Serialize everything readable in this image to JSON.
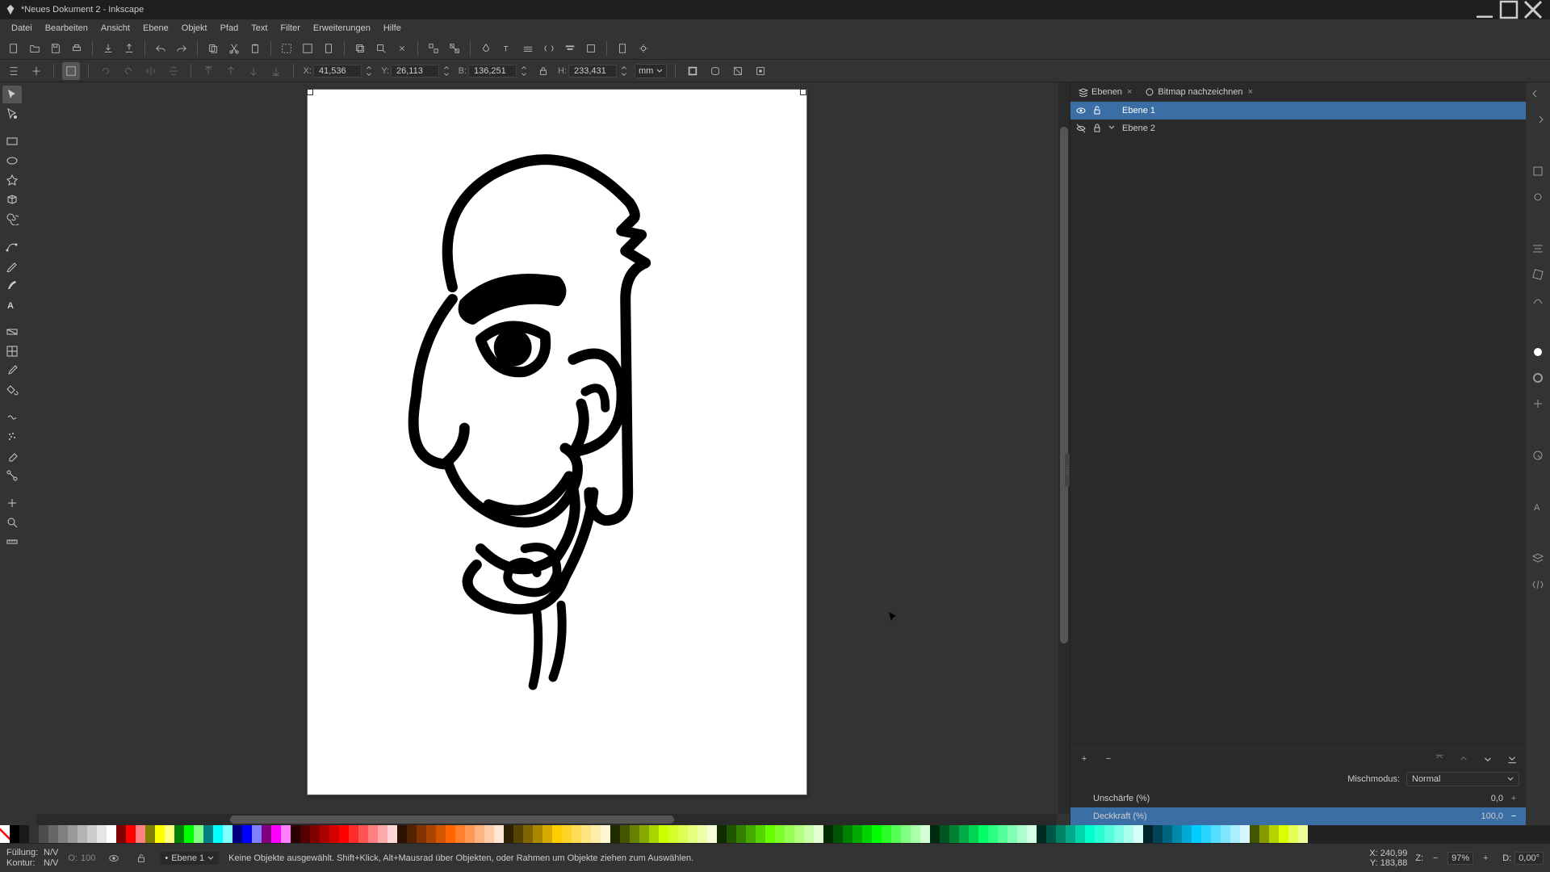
{
  "window": {
    "title": "*Neues Dokument 2 - Inkscape"
  },
  "menu": [
    "Datei",
    "Bearbeiten",
    "Ansicht",
    "Ebene",
    "Objekt",
    "Pfad",
    "Text",
    "Filter",
    "Erweiterungen",
    "Hilfe"
  ],
  "snapbar": {
    "x_label": "X:",
    "x": "41,536",
    "y_label": "Y:",
    "y": "26,113",
    "b_label": "B:",
    "b": "136,251",
    "h_label": "H:",
    "h": "233,431",
    "unit": "mm"
  },
  "panels": {
    "tab1": "Ebenen",
    "tab2": "Bitmap nachzeichnen",
    "layer1": "Ebene 1",
    "layer2": "Ebene 2",
    "blend_label": "Mischmodus:",
    "blend_value": "Normal",
    "blur_label": "Unschärfe (%)",
    "blur_value": "0,0",
    "opacity_label": "Deckkraft (%)",
    "opacity_value": "100,0"
  },
  "status": {
    "fill_label": "Füllung:",
    "fill_value": "N/V",
    "stroke_label": "Kontur:",
    "stroke_value": "N/V",
    "o_label": "O:",
    "o_value": "100",
    "layer_prefix": "•",
    "layer": "Ebene 1",
    "msg": "Keine Objekte ausgewählt. Shift+Klick, Alt+Mausrad über Objekten, oder Rahmen um Objekte ziehen zum Auswählen.",
    "coord_x_label": "X:",
    "coord_x": "240,99",
    "coord_y_label": "Y:",
    "coord_y": "183,88",
    "z_label": "Z:",
    "zoom": "97%",
    "d_label": "D:",
    "rotation": "0,00°"
  },
  "palette_colors": [
    "#000000",
    "#1a1a1a",
    "#333333",
    "#4d4d4d",
    "#666666",
    "#808080",
    "#999999",
    "#b3b3b3",
    "#cccccc",
    "#e6e6e6",
    "#ffffff",
    "#800000",
    "#ff0000",
    "#ff8080",
    "#808000",
    "#ffff00",
    "#ffff80",
    "#008000",
    "#00ff00",
    "#80ff80",
    "#008080",
    "#00ffff",
    "#80ffff",
    "#000080",
    "#0000ff",
    "#8080ff",
    "#800080",
    "#ff00ff",
    "#ff80ff",
    "#2b0000",
    "#550000",
    "#800000",
    "#aa0000",
    "#d40000",
    "#ff0000",
    "#ff2a2a",
    "#ff5555",
    "#ff8080",
    "#ffaaaa",
    "#ffd5d5",
    "#2b1100",
    "#552200",
    "#803300",
    "#aa4400",
    "#d45500",
    "#ff6600",
    "#ff7f2a",
    "#ff9955",
    "#ffb380",
    "#ffccaa",
    "#ffe6d5",
    "#2b2200",
    "#554400",
    "#806600",
    "#aa8800",
    "#d4aa00",
    "#ffcc00",
    "#ffd42a",
    "#ffdd55",
    "#ffe680",
    "#ffeeaa",
    "#fff6d5",
    "#222b00",
    "#445500",
    "#668000",
    "#88aa00",
    "#aad400",
    "#ccff00",
    "#d4ff2a",
    "#ddff55",
    "#e5ff80",
    "#eeffaa",
    "#f6ffd5",
    "#112b00",
    "#225500",
    "#338000",
    "#44aa00",
    "#55d400",
    "#66ff00",
    "#7fff2a",
    "#99ff55",
    "#b3ff80",
    "#ccffaa",
    "#e5ffd5",
    "#002b00",
    "#005500",
    "#008000",
    "#00aa00",
    "#00d400",
    "#00ff00",
    "#2aff2a",
    "#55ff55",
    "#80ff80",
    "#aaffaa",
    "#d5ffd5",
    "#002b11",
    "#005522",
    "#008033",
    "#00aa44",
    "#00d455",
    "#00ff66",
    "#2aff7f",
    "#55ff99",
    "#80ffb3",
    "#aaffcc",
    "#d5ffe5",
    "#002b22",
    "#005544",
    "#008066",
    "#00aa88",
    "#00d4aa",
    "#00ffcc",
    "#2affd4",
    "#55ffdd",
    "#80ffe6",
    "#aaffee",
    "#d5fff6",
    "#00222b",
    "#004455",
    "#006680",
    "#0088aa",
    "#00aad4",
    "#00ccff",
    "#2ad4ff",
    "#55ddff",
    "#80e5ff",
    "#aaeeff",
    "#d5f6ff",
    "#445500",
    "#889900",
    "#b4d400",
    "#d9ff00",
    "#e5ff55",
    "#eeff99"
  ]
}
